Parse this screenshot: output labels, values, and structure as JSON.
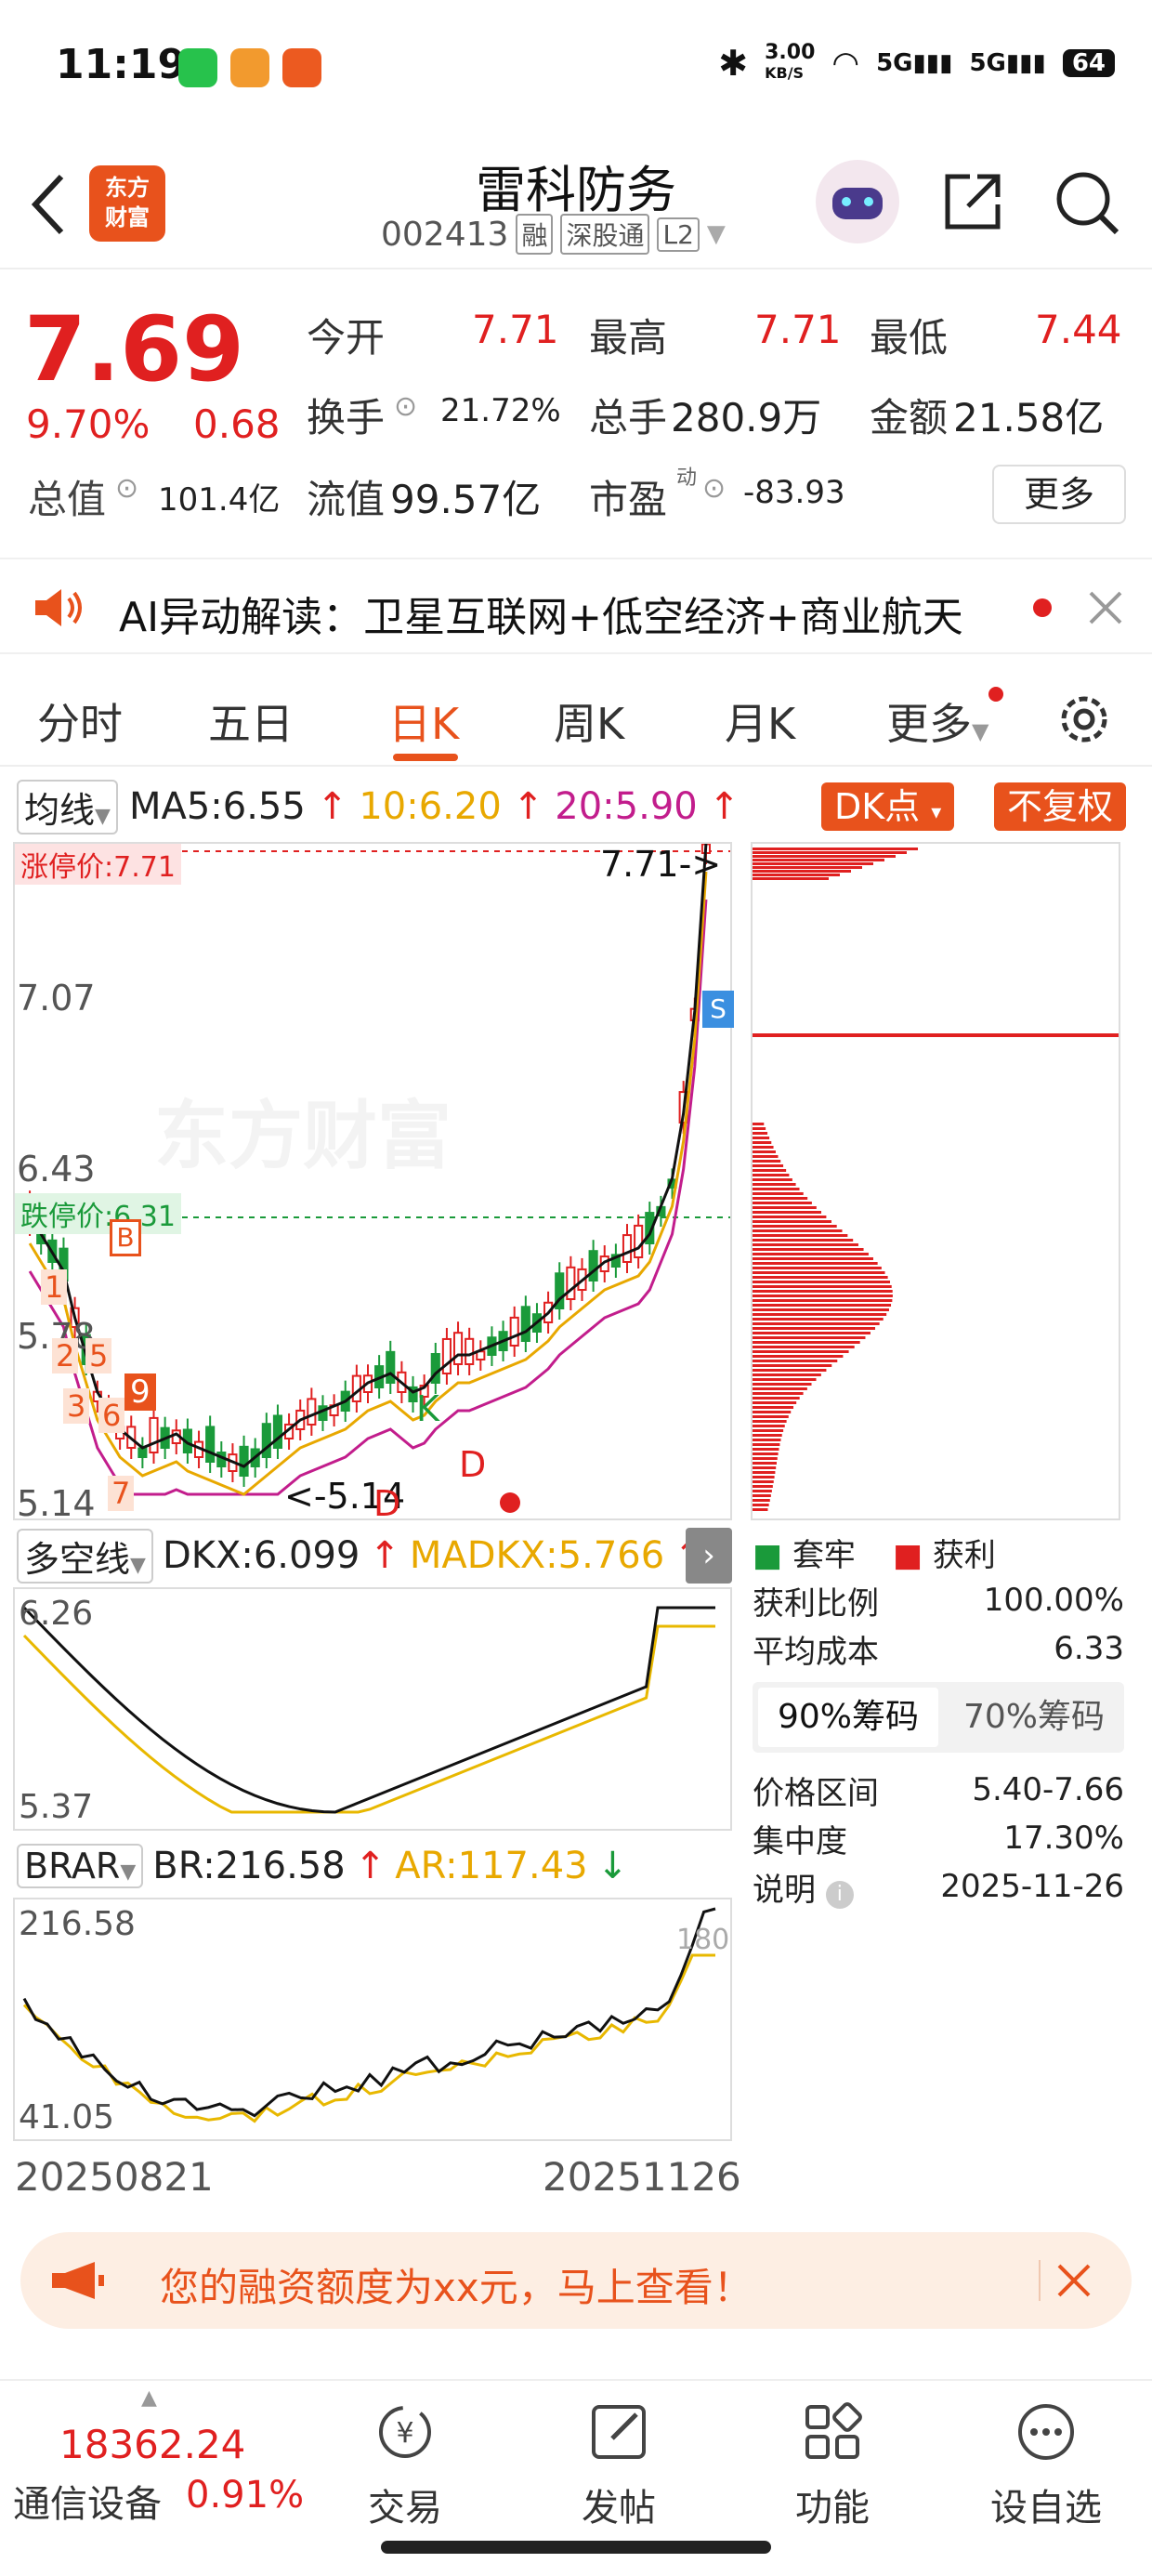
{
  "status_bar": {
    "time": "11:19",
    "net_speed_value": "3.00",
    "net_speed_unit": "KB/S",
    "signal1": "5G",
    "signal2": "5G",
    "battery": "64"
  },
  "header": {
    "logo_line1": "东方",
    "logo_line2": "财富",
    "stock_name": "雷科防务",
    "stock_code": "002413",
    "tags": [
      "融",
      "深股通",
      "L2"
    ]
  },
  "quote": {
    "price": "7.69",
    "change_pct": "9.70%",
    "change": "0.68",
    "open_label": "今开",
    "open": "7.71",
    "high_label": "最高",
    "high": "7.71",
    "low_label": "最低",
    "low": "7.44",
    "turnover_label": "换手",
    "turnover": "21.72%",
    "volume_label": "总手",
    "volume": "280.9万",
    "amount_label": "金额",
    "amount": "21.58亿",
    "mktcap_label": "总值",
    "mktcap": "101.4亿",
    "float_label": "流值",
    "float": "99.57亿",
    "pe_label": "市盈",
    "pe_sup": "动",
    "pe": "-83.93",
    "more_label": "更多"
  },
  "ai_banner": {
    "text": "AI异动解读：卫星互联网+低空经济+商业航天"
  },
  "tabs": [
    {
      "label": "分时"
    },
    {
      "label": "五日"
    },
    {
      "label": "日K"
    },
    {
      "label": "周K"
    },
    {
      "label": "月K"
    },
    {
      "label": "更多"
    }
  ],
  "ma": {
    "selector": "均线",
    "ma5": "MA5:6.55",
    "ma10": "10:6.20",
    "ma20": "20:5.90",
    "dk_btn": "DK点",
    "fq_btn": "不复权"
  },
  "main_chart": {
    "limit_up_label": "涨停价:7.71",
    "limit_down_label": "跌停价:6.31",
    "price_marker": "7.71->",
    "low_marker": "<-5.14",
    "y_labels": [
      "7.07",
      "6.43",
      "5.78",
      "5.14"
    ],
    "markers": [
      "B",
      "S",
      "K",
      "D",
      "D",
      "1",
      "2",
      "3",
      "5",
      "6",
      "7",
      "9"
    ],
    "watermark": "东方财富"
  },
  "chart_data": {
    "type": "candlestick",
    "x_start": "20250821",
    "x_end": "20251126",
    "ylim": [
      5.14,
      7.71
    ],
    "ma5": 6.55,
    "ma10": 6.2,
    "ma20": 5.9
  },
  "chips": {
    "legend_trapped": "套牢",
    "legend_profit": "获利",
    "profit_ratio_label": "获利比例",
    "profit_ratio": "100.00%",
    "avg_cost_label": "平均成本",
    "avg_cost": "6.33",
    "tab90": "90%筹码",
    "tab70": "70%筹码",
    "range_label": "价格区间",
    "range": "5.40-7.66",
    "concentration_label": "集中度",
    "concentration": "17.30%",
    "note_label": "说明",
    "note_date": "2025-11-26"
  },
  "dk": {
    "selector": "多空线",
    "dkx": "DKX:6.099",
    "madkx": "MADKX:5.766",
    "y_top": "6.26",
    "y_bottom": "5.37"
  },
  "br": {
    "selector": "BRAR",
    "br": "BR:216.58",
    "ar": "AR:117.43",
    "y_top": "216.58",
    "y_bottom": "41.05",
    "right_label": "180"
  },
  "dates": {
    "start": "20250821",
    "end": "20251126"
  },
  "promo": {
    "text": "您的融资额度为xx元，马上查看！"
  },
  "bottom": {
    "index_value": "18362.24",
    "index_name": "通信设备",
    "index_pct": "0.91%",
    "nav": [
      {
        "label": "交易"
      },
      {
        "label": "发帖"
      },
      {
        "label": "功能"
      },
      {
        "label": "设自选"
      }
    ]
  }
}
